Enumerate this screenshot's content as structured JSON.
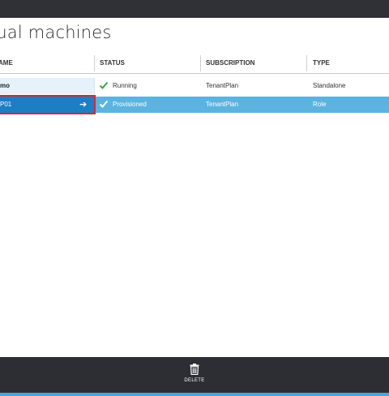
{
  "page": {
    "title": "rtual machines"
  },
  "table": {
    "columns": [
      "AME",
      "STATUS",
      "SUBSCRIPTION",
      "TYPE"
    ],
    "rows": [
      {
        "name": "mo",
        "status": "Running",
        "subscription": "TenantPlan",
        "type": "Standalone",
        "status_color": "#3aa74a"
      },
      {
        "name": "P01",
        "status": "Provisioned",
        "subscription": "TenantPlan",
        "type": "Role",
        "status_color": "#ffffff",
        "selected": true
      }
    ]
  },
  "command_bar": {
    "delete_label": "DELETE",
    "icon": "trash-icon"
  },
  "colors": {
    "top_bar": "#2f3137",
    "selected_row": "#5cb3e0",
    "selected_name": "#1c7fc2",
    "highlight_border": "#d12a36",
    "bottom_bar": "#2c2e33",
    "bottom_edge": "#4aa6d6"
  }
}
